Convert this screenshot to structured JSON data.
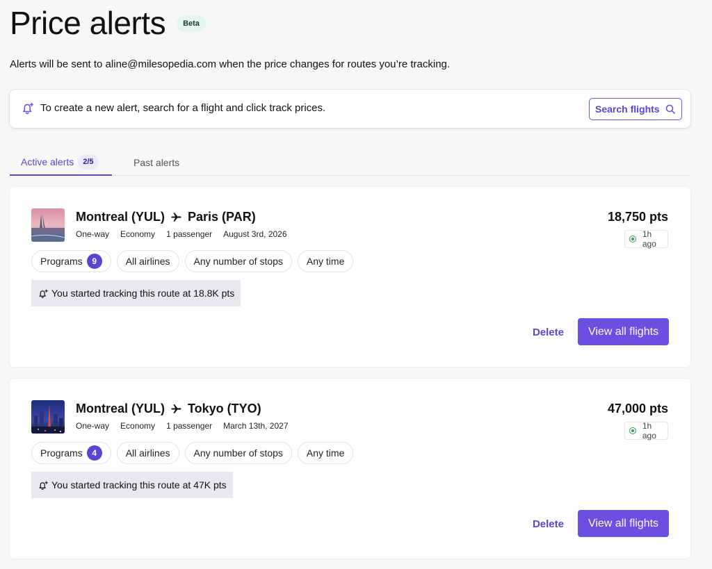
{
  "header": {
    "title": "Price alerts",
    "badge": "Beta",
    "subtitle": "Alerts will be sent to aline@milesopedia.com when the price changes for routes you’re tracking."
  },
  "info": {
    "text": "To create a new alert, search for a flight and click track prices.",
    "search_button": "Search flights"
  },
  "tabs": {
    "active_label": "Active alerts",
    "active_count": "2/5",
    "past_label": "Past alerts"
  },
  "alerts": [
    {
      "origin": "Montreal (YUL)",
      "destination": "Paris (PAR)",
      "trip_type": "One-way",
      "cabin": "Economy",
      "passengers": "1 passenger",
      "date": "August 3rd, 2026",
      "price": "18,750 pts",
      "updated": "1h ago",
      "programs_label": "Programs",
      "programs_count": "9",
      "airlines": "All airlines",
      "stops": "Any number of stops",
      "time": "Any time",
      "tracking_text": "You started tracking this route at 18.8K pts",
      "delete_label": "Delete",
      "view_label": "View all flights"
    },
    {
      "origin": "Montreal (YUL)",
      "destination": "Tokyo (TYO)",
      "trip_type": "One-way",
      "cabin": "Economy",
      "passengers": "1 passenger",
      "date": "March 13th, 2027",
      "price": "47,000 pts",
      "updated": "1h ago",
      "programs_label": "Programs",
      "programs_count": "4",
      "airlines": "All airlines",
      "stops": "Any number of stops",
      "time": "Any time",
      "tracking_text": "You started tracking this route at 47K pts",
      "delete_label": "Delete",
      "view_label": "View all flights"
    }
  ],
  "colors": {
    "accent": "#6a4fe0",
    "accent_text": "#5b43d6",
    "status_green": "#2e9b58",
    "beta_bg": "#e3f5ec"
  },
  "icons": {
    "info": "bell-plus-icon",
    "search": "search-icon",
    "plane": "airplane-icon",
    "status": "status-dot-icon",
    "tracking": "bell-plus-icon"
  }
}
